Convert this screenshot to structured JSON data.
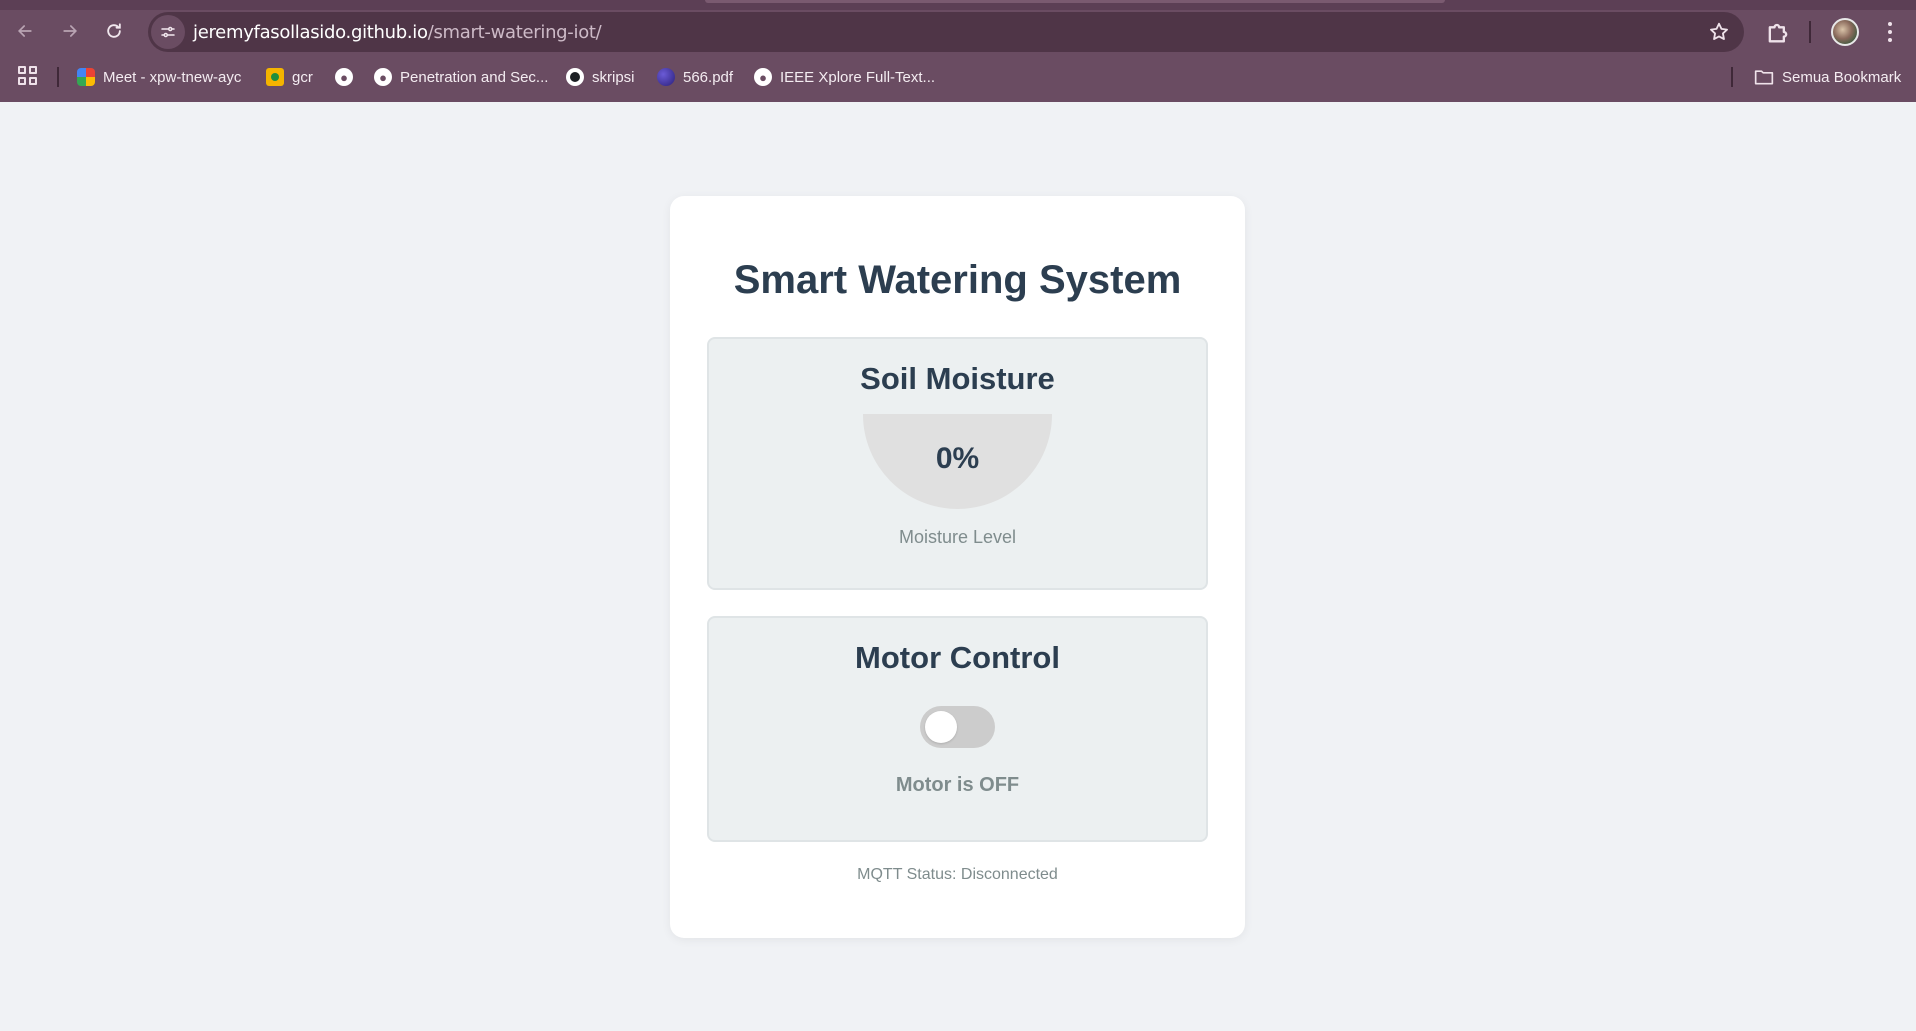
{
  "browser": {
    "url_host": "jeremyfasollasido.github.io",
    "url_path": "/smart-watering-iot/",
    "bookmarks": [
      {
        "label": "Meet - xpw-tnew-ayc",
        "icon": "google-meet-icon"
      },
      {
        "label": "gcr",
        "icon": "classroom-icon"
      },
      {
        "label": "",
        "icon": "globe-icon"
      },
      {
        "label": "Penetration and Sec...",
        "icon": "globe-icon"
      },
      {
        "label": "skripsi",
        "icon": "github-icon"
      },
      {
        "label": "566.pdf",
        "icon": "pdf-site-icon"
      },
      {
        "label": "IEEE Xplore Full-Text...",
        "icon": "globe-icon"
      }
    ],
    "all_bookmarks_label": "Semua Bookmark"
  },
  "app": {
    "title": "Smart Watering System",
    "moisture": {
      "title": "Soil Moisture",
      "value_text": "0%",
      "level": 0,
      "label": "Moisture Level"
    },
    "motor": {
      "title": "Motor Control",
      "is_on": false,
      "status": "Motor is OFF"
    },
    "mqtt_status": "MQTT Status: Disconnected"
  },
  "colors": {
    "browser_frame": "#6a4c62",
    "omnibox": "#4f3547",
    "page_background": "#f0f2f5",
    "heading": "#2c3e50",
    "muted_text": "#7f8c8d",
    "panel_background": "#ecf0f1",
    "gauge_track": "#e0e0e0",
    "toggle_off": "#cccccc"
  }
}
